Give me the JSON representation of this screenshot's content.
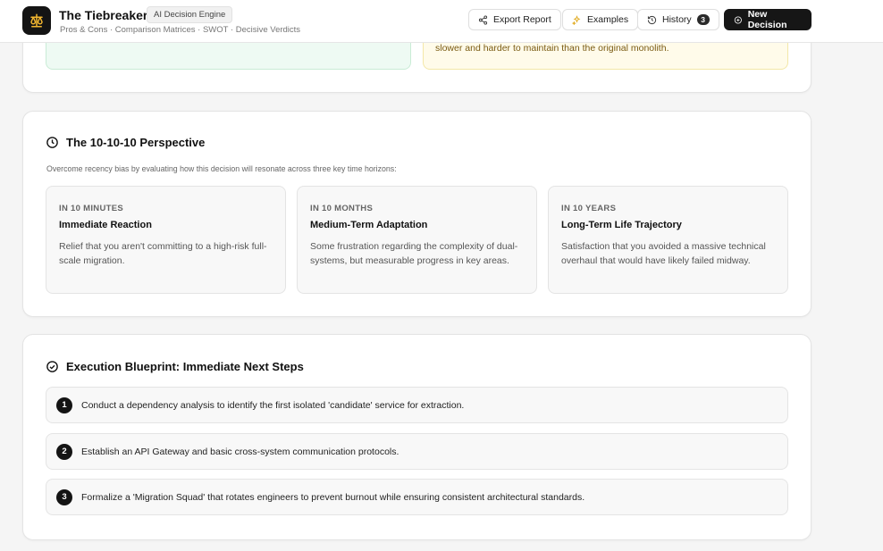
{
  "header": {
    "title": "The Tiebreaker",
    "badge": "AI Decision Engine",
    "subtitle": "Pros & Cons · Comparison Matrices · SWOT · Decisive Verdicts",
    "export_label": "Export Report",
    "examples_label": "Examples",
    "history_label": "History",
    "history_count": "3",
    "new_decision_label": "New Decision"
  },
  "risk_panel": {
    "yellow_text": "slower and harder to maintain than the original monolith."
  },
  "perspective": {
    "title": "The 10-10-10 Perspective",
    "description": "Overcome recency bias by evaluating how this decision will resonate across three key time horizons:",
    "items": [
      {
        "tag": "IN 10 MINUTES",
        "heading": "Immediate Reaction",
        "body": "Relief that you aren't committing to a high-risk full-scale migration."
      },
      {
        "tag": "IN 10 MONTHS",
        "heading": "Medium-Term Adaptation",
        "body": "Some frustration regarding the complexity of dual-systems, but measurable progress in key areas."
      },
      {
        "tag": "IN 10 YEARS",
        "heading": "Long-Term Life Trajectory",
        "body": "Satisfaction that you avoided a massive technical overhaul that would have likely failed midway."
      }
    ]
  },
  "blueprint": {
    "title": "Execution Blueprint: Immediate Next Steps",
    "steps": [
      {
        "num": "1",
        "text": "Conduct a dependency analysis to identify the first isolated 'candidate' service for extraction."
      },
      {
        "num": "2",
        "text": "Establish an API Gateway and basic cross-system communication protocols."
      },
      {
        "num": "3",
        "text": "Formalize a 'Migration Squad' that rotates engineers to prevent burnout while ensuring consistent architectural standards."
      }
    ]
  }
}
